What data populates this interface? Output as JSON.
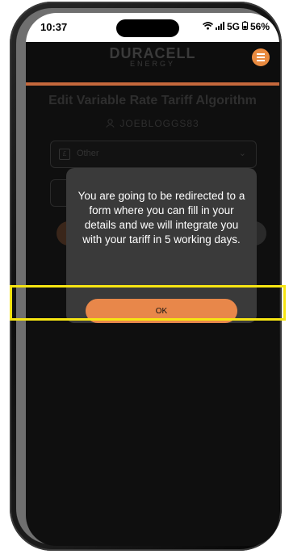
{
  "status_bar": {
    "time": "10:37",
    "network": "5G",
    "battery": "56%"
  },
  "app": {
    "logo_main": "DURACELL",
    "logo_sub": "ENERGY"
  },
  "page": {
    "title": "Edit Variable Rate Tariff Algorithm",
    "username": "JOEBLOGGS83"
  },
  "form": {
    "tariff_select_value": "Other"
  },
  "dialog": {
    "message": "You are going to be redirected to a form where you can fill in your details and we will integrate you with your tariff in 5 working days.",
    "ok_label": "OK"
  },
  "colors": {
    "accent": "#e8874a",
    "highlight": "#f6e512",
    "dialog_bg": "#3a3a3a"
  }
}
